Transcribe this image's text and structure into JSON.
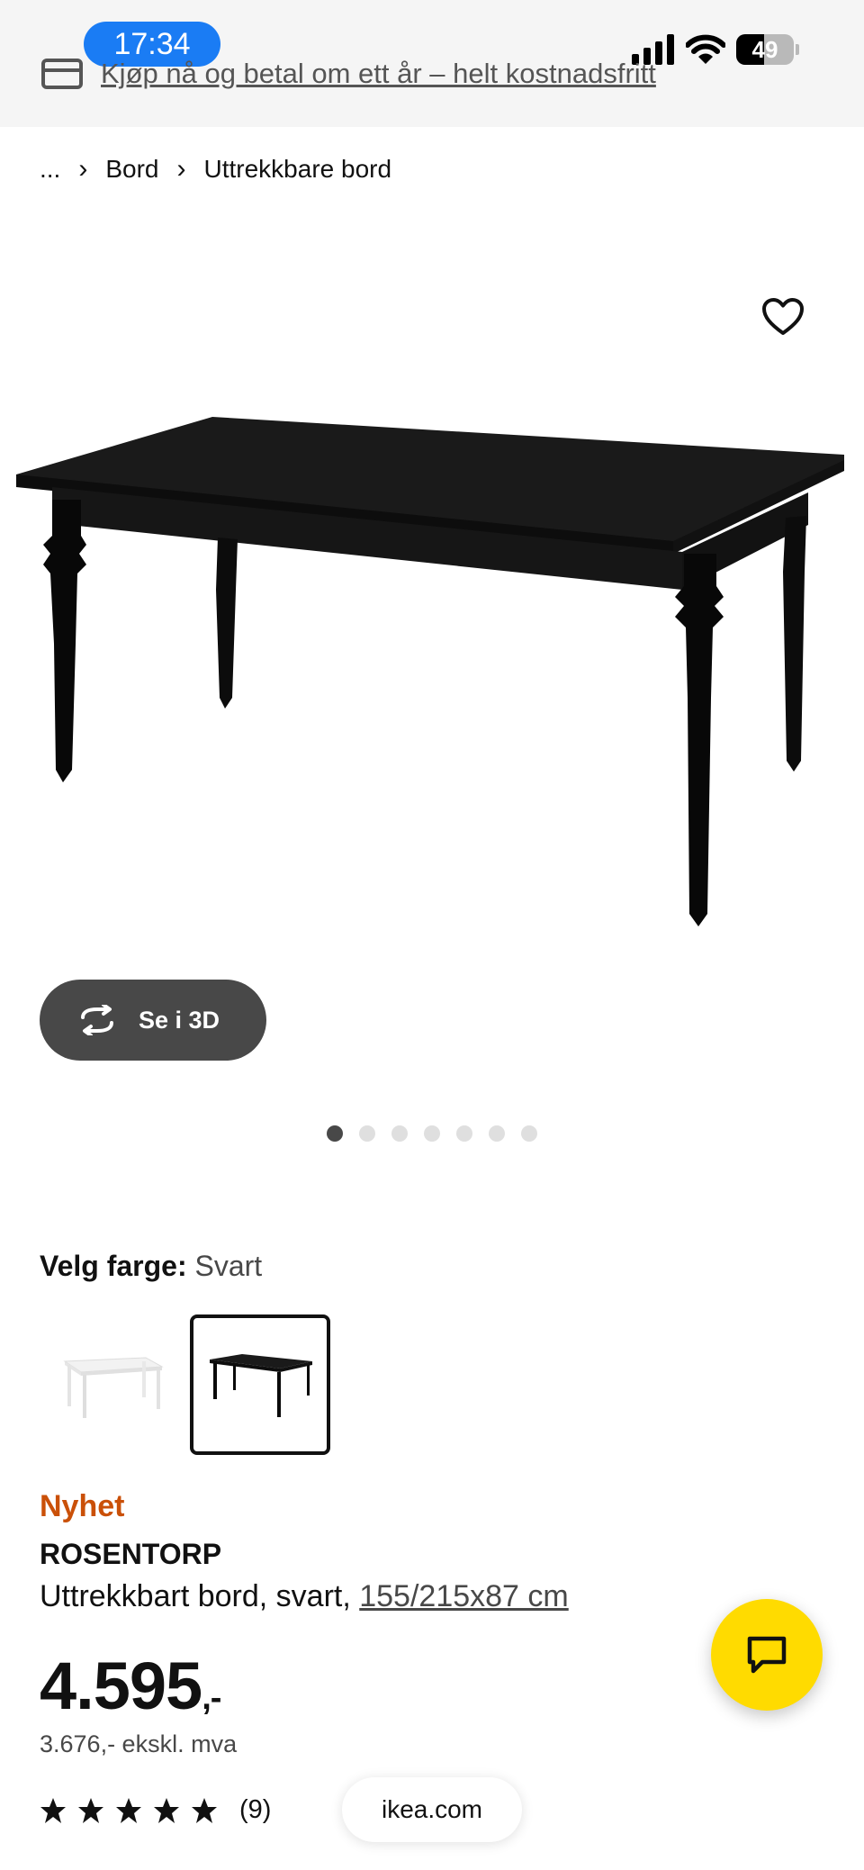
{
  "status_bar": {
    "time": "17:34",
    "battery": "49",
    "battery_level": 0.49
  },
  "promo_banner": {
    "text": "Kjøp nå og betal om ett år – helt kostnadsfritt",
    "icon": "credit-card-icon"
  },
  "breadcrumb": {
    "items": [
      "...",
      "Bord",
      "Uttrekkbare bord"
    ]
  },
  "gallery": {
    "view_3d_label": "Se i 3D",
    "dots_total": 7,
    "active_dot": 1,
    "favorite_icon": "heart-icon"
  },
  "color_picker": {
    "label": "Velg farge:",
    "selected": "Svart",
    "options": [
      "Hvit",
      "Svart"
    ]
  },
  "product": {
    "badge": "Nyhet",
    "name": "ROSENTORP",
    "description": "Uttrekkbart bord, svart, ",
    "dimensions": "155/215x87 cm",
    "price_main": "4.595",
    "price_suffix": ",-",
    "price_ex_vat": "3.676,- ekskl. mva",
    "rating_stars": 5,
    "rating_count": "(9)"
  },
  "browser": {
    "url": "ikea.com"
  },
  "colors": {
    "accent_new": "#ca5008",
    "chat_button": "#ffdb00",
    "dark_button": "#484848"
  }
}
